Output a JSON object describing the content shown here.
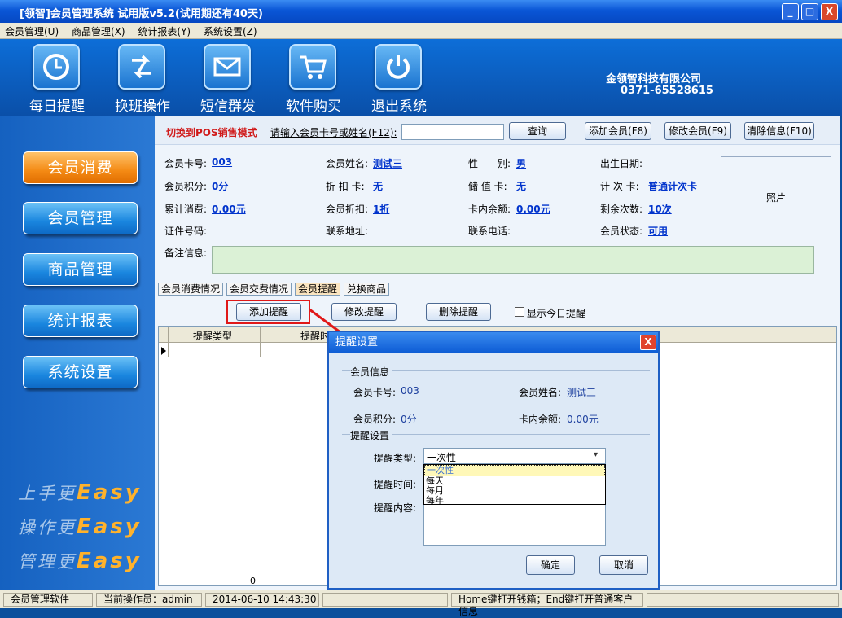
{
  "window": {
    "title": "[领智]会员管理系统 试用版v5.2(试用期还有40天)",
    "minimize": "_",
    "maximize": "□",
    "close": "X"
  },
  "menu": [
    "会员管理(U)",
    "商品管理(X)",
    "统计报表(Y)",
    "系统设置(Z)"
  ],
  "toolbar": [
    {
      "label": "每日提醒",
      "icon": "clock-icon"
    },
    {
      "label": "换班操作",
      "icon": "swap-arrows-icon"
    },
    {
      "label": "短信群发",
      "icon": "envelope-icon"
    },
    {
      "label": "软件购买",
      "icon": "cart-icon"
    },
    {
      "label": "退出系统",
      "icon": "power-icon"
    }
  ],
  "company": {
    "name": "金领智科技有限公司",
    "phone": "0371-65528615"
  },
  "nav": [
    "会员消费",
    "会员管理",
    "商品管理",
    "统计报表",
    "系统设置"
  ],
  "slogans": [
    {
      "prefix": "上手更",
      "word": "Easy"
    },
    {
      "prefix": "操作更",
      "word": "Easy"
    },
    {
      "prefix": "管理更",
      "word": "Easy"
    }
  ],
  "search": {
    "pos_mode": "切换到POS销售模式",
    "prompt": "请输入会员卡号或姓名(F12):",
    "value": "",
    "query": "查询",
    "add": "添加会员(F8)",
    "edit": "修改会员(F9)",
    "clear": "清除信息(F10)"
  },
  "info": {
    "card_label": "会员卡号:",
    "card": "003",
    "name_label": "会员姓名:",
    "name": "测试三",
    "gender_label": "性　　别:",
    "gender": "男",
    "birth_label": "出生日期:",
    "points_label": "会员积分:",
    "points": "0分",
    "discount_label": "折 扣 卡:",
    "discount": "无",
    "stored_label": "储 值 卡:",
    "stored": "无",
    "count_label": "计 次 卡:",
    "count": "普通计次卡",
    "total_label": "累计消费:",
    "total": "0.00元",
    "memdisc_label": "会员折扣:",
    "memdisc": "1折",
    "balance_label": "卡内余额:",
    "balance": "0.00元",
    "remain_label": "剩余次数:",
    "remain": "10次",
    "id_label": "证件号码:",
    "addr_label": "联系地址:",
    "phone_label": "联系电话:",
    "status_label": "会员状态:",
    "status": "可用",
    "note_label": "备注信息:",
    "photo": "照片"
  },
  "tabs": [
    "会员消费情况",
    "会员交费情况",
    "会员提醒",
    "兑换商品"
  ],
  "actions": {
    "add": "添加提醒",
    "edit": "修改提醒",
    "delete": "删除提醒",
    "today": "显示今日提醒"
  },
  "grid": {
    "columns": [
      "提醒类型",
      "提醒时"
    ],
    "footer": "0"
  },
  "dialog": {
    "title": "提醒设置",
    "close": "X",
    "group_member": "会员信息",
    "card_label": "会员卡号:",
    "card": "003",
    "name_label": "会员姓名:",
    "name": "测试三",
    "points_label": "会员积分:",
    "points": "0分",
    "balance_label": "卡内余额:",
    "balance": "0.00元",
    "group_remind": "提醒设置",
    "type_label": "提醒类型:",
    "type_value": "一次性",
    "options": [
      "一次性",
      "每天",
      "每月",
      "每年"
    ],
    "time_label": "提醒时间:",
    "content_label": "提醒内容:",
    "ok": "确定",
    "cancel": "取消"
  },
  "status": {
    "app": "会员管理软件",
    "operator": "当前操作员：admin",
    "datetime": "2014-06-10 14:43:30",
    "hint": "Home键打开钱箱；End键打开普通客户信息"
  }
}
